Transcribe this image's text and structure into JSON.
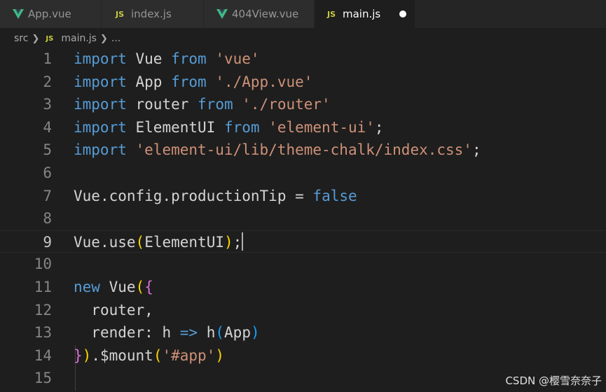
{
  "tabs": [
    {
      "label": "App.vue",
      "icon": "vue-icon",
      "active": false
    },
    {
      "label": "index.js",
      "icon": "js-icon",
      "active": false
    },
    {
      "label": "404View.vue",
      "icon": "vue-icon",
      "active": false
    },
    {
      "label": "main.js",
      "icon": "js-icon",
      "active": true,
      "dirty": true
    }
  ],
  "icons": {
    "js_badge": "JS"
  },
  "breadcrumb": {
    "folder": "src",
    "file": "main.js",
    "more": "..."
  },
  "editor": {
    "current_line": 9,
    "lines": [
      {
        "n": "1",
        "text": "import Vue from 'vue'"
      },
      {
        "n": "2",
        "text": "import App from './App.vue'"
      },
      {
        "n": "3",
        "text": "import router from './router'"
      },
      {
        "n": "4",
        "text": "import ElementUI from 'element-ui';"
      },
      {
        "n": "5",
        "text": "import 'element-ui/lib/theme-chalk/index.css';"
      },
      {
        "n": "6",
        "text": ""
      },
      {
        "n": "7",
        "text": "Vue.config.productionTip = false"
      },
      {
        "n": "8",
        "text": ""
      },
      {
        "n": "9",
        "text": "Vue.use(ElementUI);"
      },
      {
        "n": "10",
        "text": ""
      },
      {
        "n": "11",
        "text": "new Vue({"
      },
      {
        "n": "12",
        "text": "  router,"
      },
      {
        "n": "13",
        "text": "  render: h => h(App)"
      },
      {
        "n": "14",
        "text": "}).$mount('#app')"
      },
      {
        "n": "15",
        "text": ""
      }
    ]
  },
  "watermark": "CSDN @樱雪奈奈子",
  "colors": {
    "keyword": "#569cd6",
    "string": "#ce9178",
    "identifier": "#d4d4d4",
    "bracket_gold": "#ffd700",
    "bracket_orchid": "#da70d6",
    "bracket_blue": "#179fff",
    "vue_green": "#41b883",
    "js_yellow": "#cbcb41",
    "background": "#1e1e1e"
  }
}
